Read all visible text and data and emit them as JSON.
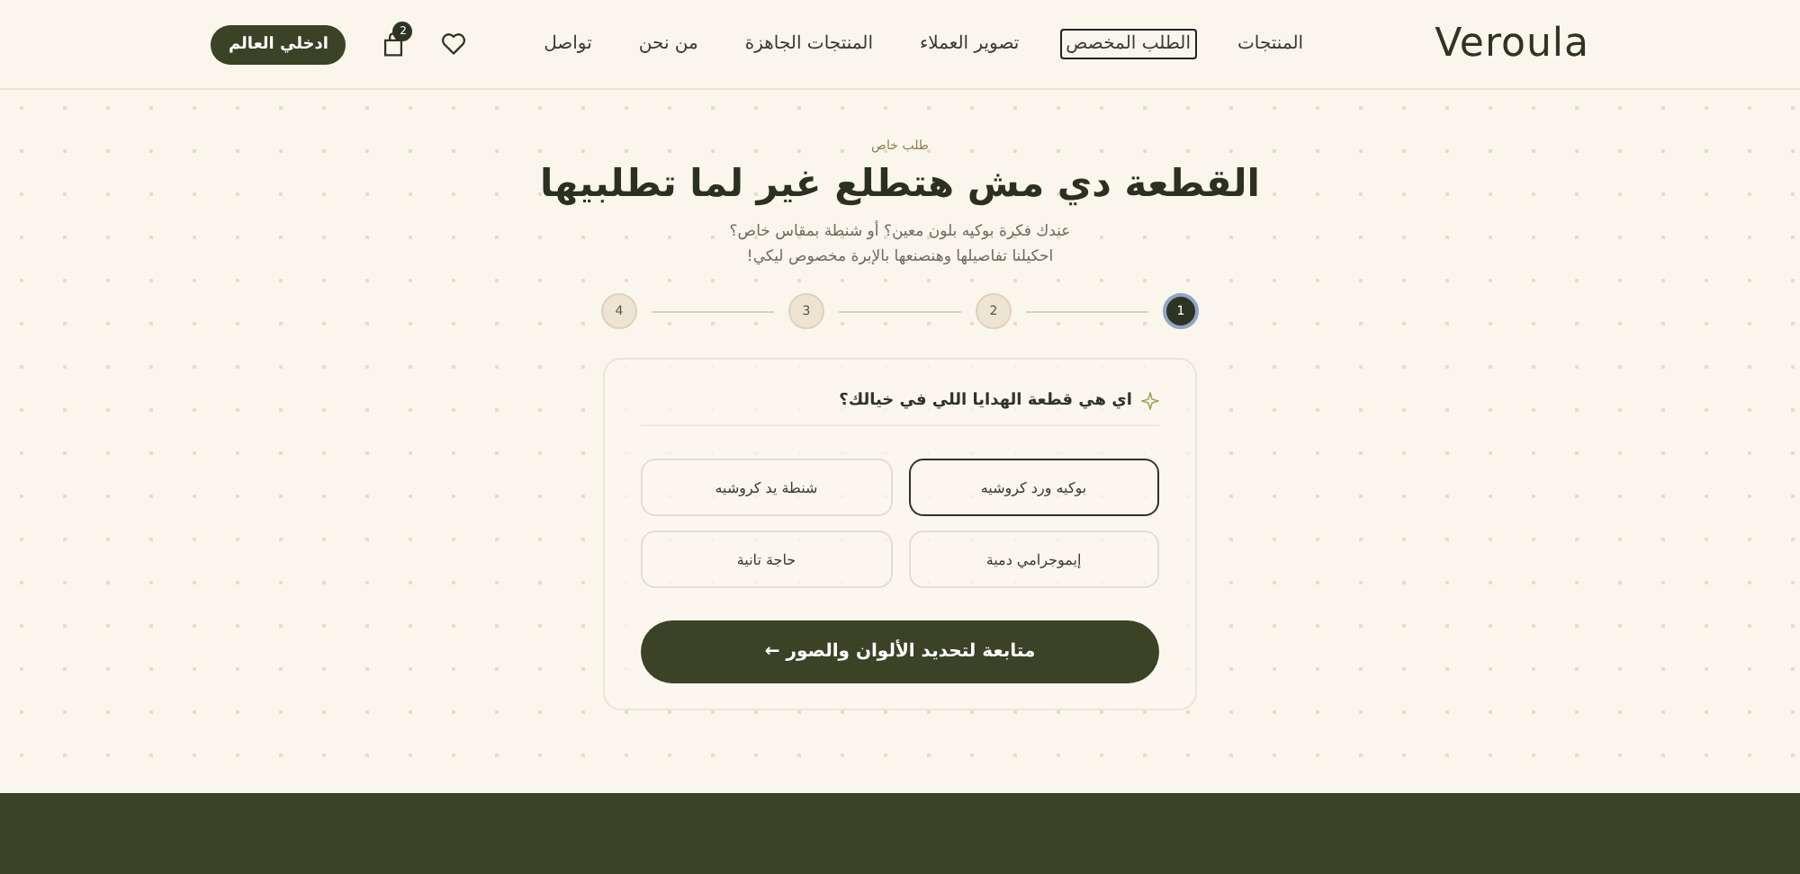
{
  "header": {
    "logo": "Veroula",
    "nav": [
      {
        "label": "المنتجات",
        "selected": false
      },
      {
        "label": "الطلب المخصص",
        "selected": true
      },
      {
        "label": "تصوير العملاء",
        "selected": false
      },
      {
        "label": "المنتجات الجاهزة",
        "selected": false
      },
      {
        "label": "من نحن",
        "selected": false
      },
      {
        "label": "تواصل",
        "selected": false
      }
    ],
    "cart_count": "2",
    "cta": "ادخلي العالم"
  },
  "hero": {
    "eyebrow": "طلب خاص",
    "title": "القطعة دي مش هتطلع غير لما تطلبيها",
    "subtitle": "عندك فكرة بوكيه بلون معين؟ أو شنطة بمقاس خاص؟ احكيلنا تفاصيلها وهنصنعها بالإبرة مخصوص ليكي!"
  },
  "steps": [
    {
      "label": "1",
      "selected": true
    },
    {
      "label": "2",
      "selected": false
    },
    {
      "label": "3",
      "selected": false
    },
    {
      "label": "4",
      "selected": false
    }
  ],
  "card": {
    "question": "اي هي قطعة الهدايا اللي في خيالك؟",
    "options": [
      {
        "label": "بوكيه ورد كروشيه",
        "selected": true
      },
      {
        "label": "شنطة يد كروشيه",
        "selected": false
      },
      {
        "label": "إيموجرامي دمية",
        "selected": false
      },
      {
        "label": "حاجة تانية",
        "selected": false
      }
    ],
    "continue": "متابعة لتحديد الألوان والصور ←"
  }
}
